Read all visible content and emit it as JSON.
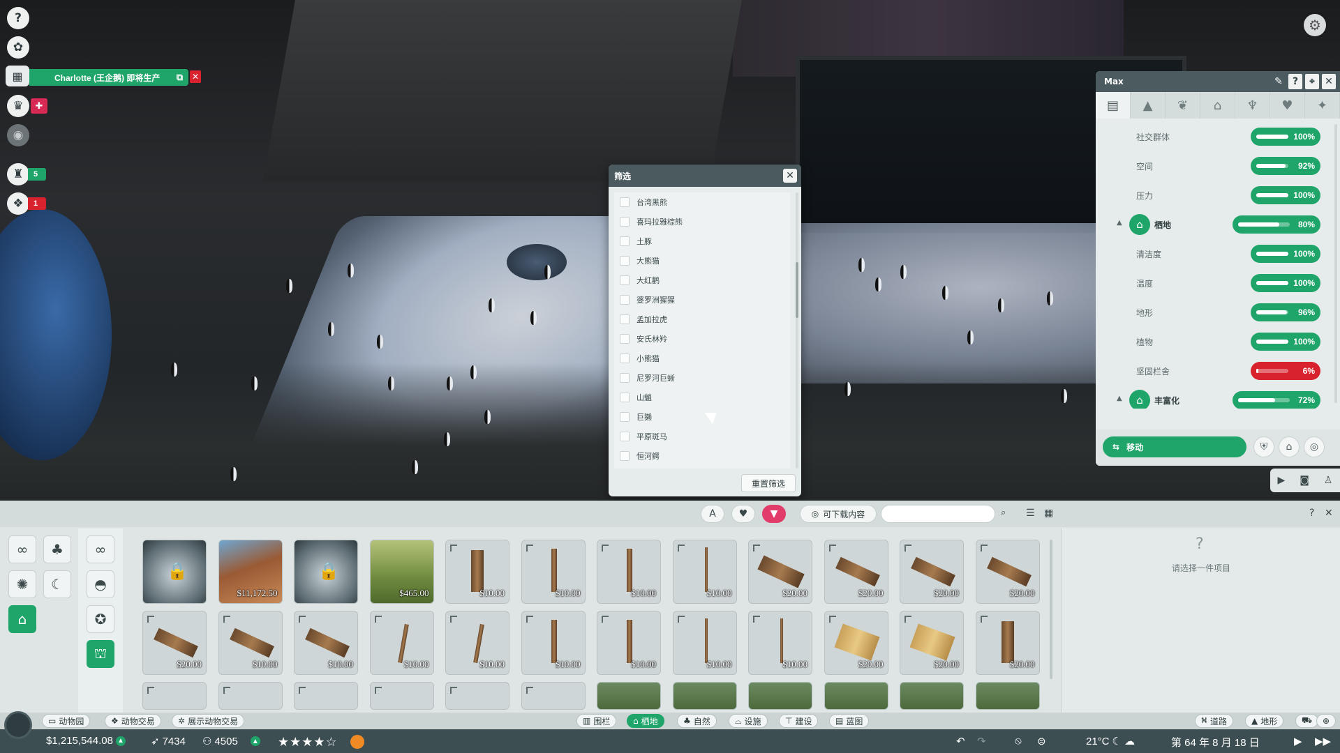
{
  "note": {
    "text": "Charlotte (王企鹅) 即将生产"
  },
  "left_hud": {
    "badge_green_count": "5",
    "badge_red_count": "1",
    "colors": {
      "green": "#1fa56a",
      "red": "#d8222d"
    },
    "icons": [
      "help-icon",
      "animal-icon",
      "calendar-icon",
      "trophy-icon",
      "gift-icon",
      "eye-icon",
      "staff-icon",
      "paw-icon"
    ]
  },
  "filter": {
    "title": "筛选",
    "items": [
      "台湾黑熊",
      "喜玛拉雅棕熊",
      "土豚",
      "大熊猫",
      "大红鹳",
      "婆罗洲猩猩",
      "孟加拉虎",
      "安氏林羚",
      "小熊猫",
      "尼罗河巨蜥",
      "山魈",
      "巨獭",
      "平原斑马",
      "恒河鳄"
    ],
    "reset_label": "重置筛选"
  },
  "panel": {
    "title": "Max",
    "tabs": [
      "info-tab",
      "terrain-tab",
      "plant-tab",
      "habitat-tab",
      "family-tab",
      "welfare-tab",
      "genetics-tab"
    ],
    "stats": [
      {
        "label": "社交群体",
        "value": "100%",
        "fraction": 1.0,
        "status": "good",
        "group": false
      },
      {
        "label": "空间",
        "value": "92%",
        "fraction": 0.92,
        "status": "good",
        "group": false
      },
      {
        "label": "压力",
        "value": "100%",
        "fraction": 1.0,
        "status": "good",
        "group": false
      },
      {
        "label": "栖地",
        "value": "80%",
        "fraction": 0.8,
        "status": "good",
        "group": true
      },
      {
        "label": "清洁度",
        "value": "100%",
        "fraction": 1.0,
        "status": "good",
        "group": false
      },
      {
        "label": "温度",
        "value": "100%",
        "fraction": 1.0,
        "status": "good",
        "group": false
      },
      {
        "label": "地形",
        "value": "96%",
        "fraction": 0.96,
        "status": "good",
        "group": false
      },
      {
        "label": "植物",
        "value": "100%",
        "fraction": 1.0,
        "status": "good",
        "group": false
      },
      {
        "label": "坚固栏舍",
        "value": "6%",
        "fraction": 0.06,
        "status": "bad",
        "group": false
      },
      {
        "label": "丰富化",
        "value": "72%",
        "fraction": 0.72,
        "status": "good",
        "group": true
      }
    ],
    "move_label": "移动"
  },
  "browser": {
    "dlc_label": "可下载内容",
    "search_value": "",
    "info_text": "请选择一件项目",
    "tiles": [
      {
        "price": "",
        "kind": "locked-dome"
      },
      {
        "price": "$11,172.50",
        "kind": "rock"
      },
      {
        "price": "",
        "kind": "locked-dome"
      },
      {
        "price": "$465.00",
        "kind": "fence"
      },
      {
        "price": "$10.00",
        "kind": "log"
      },
      {
        "price": "$10.00",
        "kind": "post"
      },
      {
        "price": "$10.00",
        "kind": "post"
      },
      {
        "price": "$10.00",
        "kind": "pole"
      },
      {
        "price": "$20.00",
        "kind": "logs"
      },
      {
        "price": "$20.00",
        "kind": "plank"
      },
      {
        "price": "$20.00",
        "kind": "plank"
      },
      {
        "price": "$20.00",
        "kind": "plank"
      },
      {
        "price": "$20.00",
        "kind": "plank"
      },
      {
        "price": "$10.00",
        "kind": "plank"
      },
      {
        "price": "$10.00",
        "kind": "plank"
      },
      {
        "price": "$10.00",
        "kind": "branch"
      },
      {
        "price": "$10.00",
        "kind": "branch"
      },
      {
        "price": "$10.00",
        "kind": "post"
      },
      {
        "price": "$10.00",
        "kind": "post"
      },
      {
        "price": "$10.00",
        "kind": "pole"
      },
      {
        "price": "$10.00",
        "kind": "pole"
      },
      {
        "price": "$20.00",
        "kind": "platform"
      },
      {
        "price": "$20.00",
        "kind": "platform"
      },
      {
        "price": "$20.00",
        "kind": "log"
      },
      {
        "price": "",
        "kind": "partial"
      },
      {
        "price": "",
        "kind": "partial"
      },
      {
        "price": "",
        "kind": "partial"
      },
      {
        "price": "",
        "kind": "partial"
      },
      {
        "price": "",
        "kind": "partial"
      },
      {
        "price": "",
        "kind": "partial"
      },
      {
        "price": "",
        "kind": "partial-photo"
      },
      {
        "price": "",
        "kind": "partial-photo"
      },
      {
        "price": "",
        "kind": "partial-photo"
      },
      {
        "price": "",
        "kind": "partial-photo"
      },
      {
        "price": "",
        "kind": "partial-photo"
      },
      {
        "price": "",
        "kind": "partial-photo"
      }
    ]
  },
  "mode_bar": {
    "left": [
      "动物园",
      "动物交易",
      "展示动物交易"
    ],
    "center": [
      "围栏",
      "栖地",
      "自然",
      "设施",
      "建设",
      "蓝图"
    ],
    "center_active": "栖地",
    "right": [
      "道路",
      "地形"
    ]
  },
  "status": {
    "money": "$1,215,544.08",
    "guests_rating": "7434",
    "guests": "4505",
    "stars": "★★★★☆",
    "temperature": "21°C",
    "date": "第 64 年 8 月 18 日"
  }
}
